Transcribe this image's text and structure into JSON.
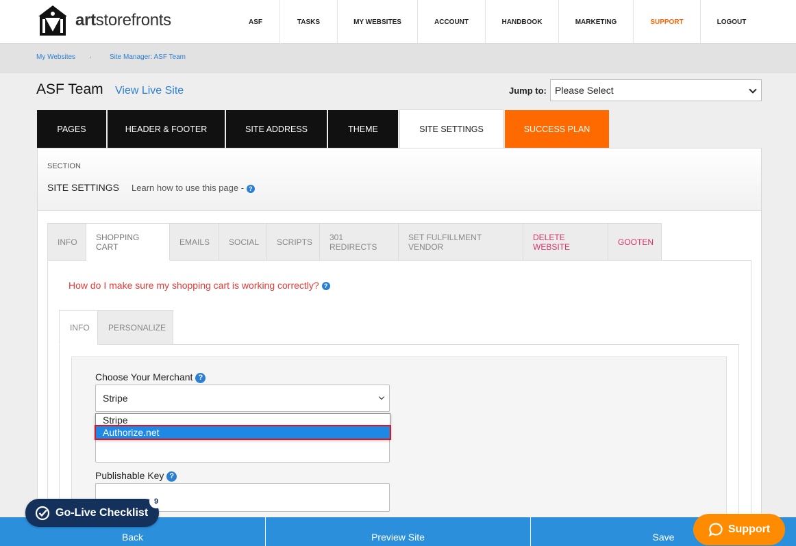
{
  "brand": {
    "name_bold": "art",
    "name_rest": "storefronts"
  },
  "nav": [
    {
      "label": "ASF",
      "key": "asf"
    },
    {
      "label": "TASKS",
      "key": "tasks"
    },
    {
      "label": "MY WEBSITES",
      "key": "my-websites"
    },
    {
      "label": "ACCOUNT",
      "key": "account"
    },
    {
      "label": "HANDBOOK",
      "key": "handbook"
    },
    {
      "label": "MARKETING",
      "key": "marketing"
    },
    {
      "label": "SUPPORT",
      "key": "support"
    },
    {
      "label": "LOGOUT",
      "key": "logout"
    }
  ],
  "breadcrumb": {
    "items": [
      "My Websites",
      "Site Manager: ASF Team"
    ],
    "separator": "."
  },
  "page": {
    "title": "ASF Team",
    "live_link": "View Live Site"
  },
  "jump": {
    "label": "Jump to:",
    "value": "Please Select"
  },
  "main_tabs": [
    "PAGES",
    "HEADER & FOOTER",
    "SITE ADDRESS",
    "THEME",
    "SITE SETTINGS",
    "SUCCESS PLAN"
  ],
  "section": {
    "caption": "SECTION",
    "title": "SITE SETTINGS",
    "learn": "Learn how to use this page -"
  },
  "sub_tabs": [
    "INFO",
    "SHOPPING CART",
    "EMAILS",
    "SOCIAL",
    "SCRIPTS",
    "301 REDIRECTS",
    "SET FULFILLMENT VENDOR",
    "DELETE WEBSITE",
    "GOOTEN"
  ],
  "cart": {
    "question": "How do I make sure my shopping cart is working correctly?"
  },
  "inner_tabs": [
    "INFO",
    "PERSONALIZE"
  ],
  "form": {
    "merchant_label": "Choose Your Merchant",
    "merchant_value": "Stripe",
    "options": [
      "Stripe",
      "Authorize.net"
    ],
    "publishable_label": "Publishable Key"
  },
  "bottom": {
    "back": "Back",
    "preview": "Preview Site",
    "save": "Save"
  },
  "golive": {
    "label": "Go-Live Checklist",
    "count": "9"
  },
  "support_button": "Support",
  "icons": {
    "help": "?",
    "colors": {
      "accent": "#2a7fd4",
      "orange": "#ff6a00",
      "danger": "#e53935"
    }
  }
}
